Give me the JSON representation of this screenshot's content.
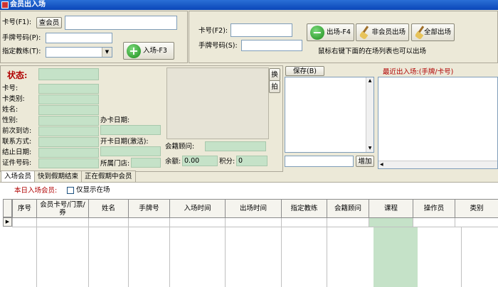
{
  "window": {
    "title": "会员出入场"
  },
  "entry": {
    "card_label": "卡号(F1):",
    "query_member_btn": "查会员",
    "card_value": "",
    "tag_label": "手牌号码(P):",
    "tag_value": "",
    "coach_label": "指定教练(T):",
    "coach_value": "",
    "enter_btn": "入场-F3"
  },
  "exit": {
    "card_label": "卡号(F2):",
    "card_value": "",
    "tag_label": "手牌号码(S):",
    "tag_value": "",
    "exit_btn": "出场-F4",
    "nonmember_btn": "非会员出场",
    "all_exit_btn": "全部出场",
    "hint": "鼠标右键下面的在场列表也可以出场"
  },
  "status": {
    "title": "状态:",
    "fields": [
      "卡号:",
      "卡类别:",
      "姓名:",
      "性别:",
      "前次到访:",
      "联系方式:",
      "结止日期:",
      "证件号码:"
    ],
    "card_open_date_label": "办卡日期:",
    "activate_date_label": "开卡日期(激活):",
    "store_label": "所属门店:",
    "switch_btn": "换",
    "shoot_btn": "拍",
    "advisor_label": "会籍顾问:",
    "balance_label": "余额:",
    "balance_value": "0.00",
    "points_label": "积分:",
    "points_value": "0"
  },
  "save_panel": {
    "save_btn": "保存(B)",
    "add_btn": "增加",
    "input_value": ""
  },
  "recent": {
    "title": "最近出入场:(手牌/卡号)"
  },
  "tabs": [
    "入场会员",
    "快到假期结束",
    "正在假期中会员"
  ],
  "today": {
    "label": "本日入场会员:",
    "checkbox_label": "仅显示在场",
    "checked": false
  },
  "table": {
    "columns": [
      "序号",
      "会员卡号/门票/券",
      "姓名",
      "手牌号",
      "入场时间",
      "出场时间",
      "指定教练",
      "会籍顾问",
      "课程",
      "操作员",
      "类别"
    ],
    "rows": []
  },
  "colors": {
    "title_bar": "#0a46b8",
    "status_title": "#b00000",
    "field_green": "#c5e2c8",
    "recent_title": "#b00000"
  }
}
